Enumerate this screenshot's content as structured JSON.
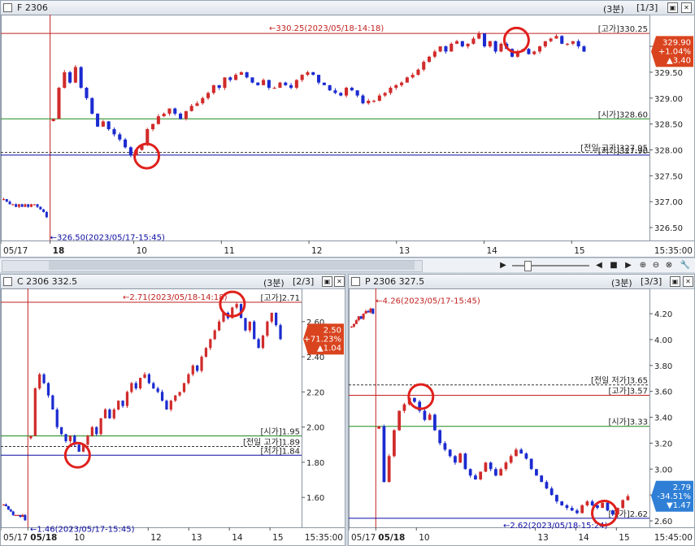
{
  "colors": {
    "up": "#d12b2b",
    "down": "#1b2bd0",
    "high_line": "#c22020",
    "open_line": "#1c8a1c",
    "low_line": "#0b0ba0",
    "prev_line": "#333333",
    "badge_up": "#d9441f",
    "badge_down": "#2f7fd6"
  },
  "panels": [
    {
      "key": "p1",
      "title": "F 2306",
      "period": "(3분)",
      "page": "[1/3]",
      "price_badge": [
        "329.90",
        "+1.04%",
        "▲3.40"
      ],
      "badge_dir": "up",
      "y_labels": [
        "330.00",
        "329.50",
        "329.00",
        "328.50",
        "328.00",
        "327.50",
        "327.00",
        "326.50"
      ],
      "y_values": [
        330.0,
        329.5,
        329.0,
        328.5,
        328.0,
        327.5,
        327.0,
        326.5
      ],
      "y_range": [
        326.25,
        330.55
      ],
      "x_labels": [
        "05/17",
        "18",
        "10",
        "11",
        "12",
        "13",
        "14",
        "15",
        "15:35:00"
      ],
      "x_pos": [
        0.0,
        0.076,
        0.205,
        0.34,
        0.475,
        0.61,
        0.745,
        0.88,
        1.0
      ],
      "session_split": 0.076,
      "hlines": [
        {
          "label": "[고가]330.25",
          "value": 330.25,
          "kind": "high"
        },
        {
          "label": "[시가]328.60",
          "value": 328.6,
          "kind": "open"
        },
        {
          "label": "[저가]327.90",
          "value": 327.9,
          "kind": "low"
        },
        {
          "label": "[전일 고가]327.95",
          "value": 327.95,
          "kind": "prev"
        }
      ],
      "annotations": [
        {
          "text": "330.25(2023/05/18-14:18)",
          "value": 330.25,
          "kind": "high"
        },
        {
          "text": "326.50(2023/05/17-15:45)",
          "value": 326.45,
          "kind": "low"
        }
      ],
      "circles": [
        {
          "x": 0.795,
          "value": 330.12
        },
        {
          "x": 0.225,
          "value": 327.88
        }
      ],
      "prev_session": [
        327.05,
        327.0,
        326.95,
        326.95,
        326.9,
        326.95,
        326.9,
        326.95,
        326.9,
        326.95,
        326.95,
        326.9,
        326.85,
        326.8,
        326.7
      ],
      "path": [
        328.6,
        329.2,
        329.5,
        329.3,
        329.6,
        329.2,
        329.0,
        328.7,
        328.45,
        328.55,
        328.4,
        328.3,
        328.2,
        328.05,
        327.9,
        328.0,
        328.1,
        328.4,
        328.5,
        328.65,
        328.7,
        328.8,
        328.7,
        328.6,
        328.75,
        328.85,
        328.9,
        329.0,
        329.1,
        329.25,
        329.2,
        329.4,
        329.35,
        329.45,
        329.5,
        329.4,
        329.3,
        329.25,
        329.35,
        329.2,
        329.2,
        329.3,
        329.25,
        329.2,
        329.35,
        329.45,
        329.5,
        329.45,
        329.3,
        329.25,
        329.15,
        329.1,
        329.05,
        329.2,
        329.15,
        329.05,
        328.9,
        328.95,
        328.95,
        329.05,
        329.1,
        329.2,
        329.25,
        329.3,
        329.4,
        329.45,
        329.55,
        329.7,
        329.8,
        329.9,
        330.0,
        329.9,
        330.05,
        330.1,
        330.0,
        330.05,
        330.15,
        330.25,
        330.0,
        330.1,
        329.9,
        330.05,
        329.95,
        329.8,
        329.9,
        329.95,
        329.85,
        329.9,
        330.0,
        330.1,
        330.15,
        330.2,
        330.05,
        330.05,
        330.1,
        330.0,
        329.9
      ]
    },
    {
      "key": "p2",
      "title": "C 2306 332.5",
      "period": "(3분)",
      "page": "[2/3]",
      "price_badge": [
        "2.50",
        "+71.23%",
        "▲1.04"
      ],
      "badge_dir": "up",
      "y_labels": [
        "2.60",
        "2.40",
        "2.20",
        "2.00",
        "1.80",
        "1.60"
      ],
      "y_values": [
        2.6,
        2.4,
        2.2,
        2.0,
        1.8,
        1.6
      ],
      "y_range": [
        1.43,
        2.77
      ],
      "x_labels": [
        "05/17",
        "05/18",
        "10",
        "12",
        "13",
        "14",
        "15",
        "15:35:00"
      ],
      "x_pos": [
        0.0,
        0.09,
        0.235,
        0.49,
        0.625,
        0.76,
        0.895,
        1.0
      ],
      "session_split": 0.09,
      "hlines": [
        {
          "label": "[고가]2.71",
          "value": 2.71,
          "kind": "high"
        },
        {
          "label": "[시가]1.95",
          "value": 1.95,
          "kind": "open"
        },
        {
          "label": "[전일 고가]1.89",
          "value": 1.89,
          "kind": "prev"
        },
        {
          "label": "[저가]1.84",
          "value": 1.84,
          "kind": "low"
        }
      ],
      "annotations": [
        {
          "text": "2.71(2023/05/18-14:18)",
          "value": 2.71,
          "kind": "high"
        },
        {
          "text": "1.46(2023/05/17-15:45)",
          "value": 1.46,
          "kind": "low"
        }
      ],
      "circles": [
        {
          "x": 0.77,
          "value": 2.7
        },
        {
          "x": 0.255,
          "value": 1.84
        }
      ],
      "prev_session": [
        1.56,
        1.55,
        1.53,
        1.52,
        1.5,
        1.5,
        1.5,
        1.49,
        1.5,
        1.47
      ],
      "path": [
        1.95,
        2.22,
        2.3,
        2.25,
        2.18,
        2.1,
        2.0,
        1.96,
        1.92,
        1.95,
        1.9,
        1.86,
        1.9,
        1.95,
        2.0,
        1.96,
        2.05,
        2.1,
        2.05,
        2.1,
        2.15,
        2.12,
        2.2,
        2.25,
        2.22,
        2.28,
        2.3,
        2.25,
        2.22,
        2.2,
        2.15,
        2.1,
        2.15,
        2.18,
        2.2,
        2.25,
        2.3,
        2.35,
        2.32,
        2.4,
        2.45,
        2.5,
        2.55,
        2.6,
        2.65,
        2.62,
        2.68,
        2.7,
        2.62,
        2.55,
        2.6,
        2.5,
        2.45,
        2.52,
        2.6,
        2.65,
        2.58,
        2.5
      ]
    },
    {
      "key": "p3",
      "title": "P 2306 327.5",
      "period": "(3분)",
      "page": "[3/3]",
      "price_badge": [
        "2.79",
        "-34.51%",
        "▼1.47"
      ],
      "badge_dir": "down",
      "y_labels": [
        "4.20",
        "4.00",
        "3.80",
        "3.60",
        "3.40",
        "3.20",
        "3.00",
        "2.80",
        "2.60"
      ],
      "y_values": [
        4.2,
        4.0,
        3.8,
        3.6,
        3.4,
        3.2,
        3.0,
        2.8,
        2.6
      ],
      "y_range": [
        2.55,
        4.37
      ],
      "x_labels": [
        "05/17",
        "05/18",
        "10",
        "13",
        "14",
        "15",
        "15:45:00"
      ],
      "x_pos": [
        0.0,
        0.09,
        0.225,
        0.62,
        0.755,
        0.89,
        1.0
      ],
      "session_split": 0.09,
      "hlines": [
        {
          "label": "[전일 저가]3.65",
          "value": 3.65,
          "kind": "prev"
        },
        {
          "label": "[고가]3.57",
          "value": 3.57,
          "kind": "high"
        },
        {
          "label": "[시가]3.33",
          "value": 3.33,
          "kind": "open"
        },
        {
          "label": "[저가]2.62",
          "value": 2.62,
          "kind": "low"
        }
      ],
      "annotations": [
        {
          "text": "4.26(2023/05/17-15:45)",
          "value": 4.26,
          "kind": "high"
        },
        {
          "text": "2.62(2023/05/18-15:24)",
          "value": 2.62,
          "kind": "low"
        }
      ],
      "circles": [
        {
          "x": 0.24,
          "value": 3.56
        },
        {
          "x": 0.85,
          "value": 2.66
        }
      ],
      "prev_session": [
        4.1,
        4.12,
        4.15,
        4.18,
        4.16,
        4.2,
        4.22,
        4.21,
        4.24,
        4.2
      ],
      "path": [
        3.33,
        2.9,
        3.1,
        3.3,
        3.45,
        3.5,
        3.55,
        3.52,
        3.45,
        3.38,
        3.42,
        3.3,
        3.2,
        3.15,
        3.1,
        3.05,
        3.12,
        3.0,
        2.95,
        2.92,
        2.98,
        3.05,
        3.0,
        2.95,
        3.0,
        3.05,
        3.1,
        3.15,
        3.12,
        3.08,
        3.0,
        2.95,
        2.9,
        2.85,
        2.8,
        2.75,
        2.72,
        2.7,
        2.68,
        2.66,
        2.72,
        2.75,
        2.72,
        2.7,
        2.74,
        2.68,
        2.65,
        2.7,
        2.76,
        2.79
      ]
    }
  ],
  "scroll_icons": [
    "◀",
    "■",
    "▶",
    "⊕",
    "⊖",
    "⊗",
    "🔧"
  ]
}
